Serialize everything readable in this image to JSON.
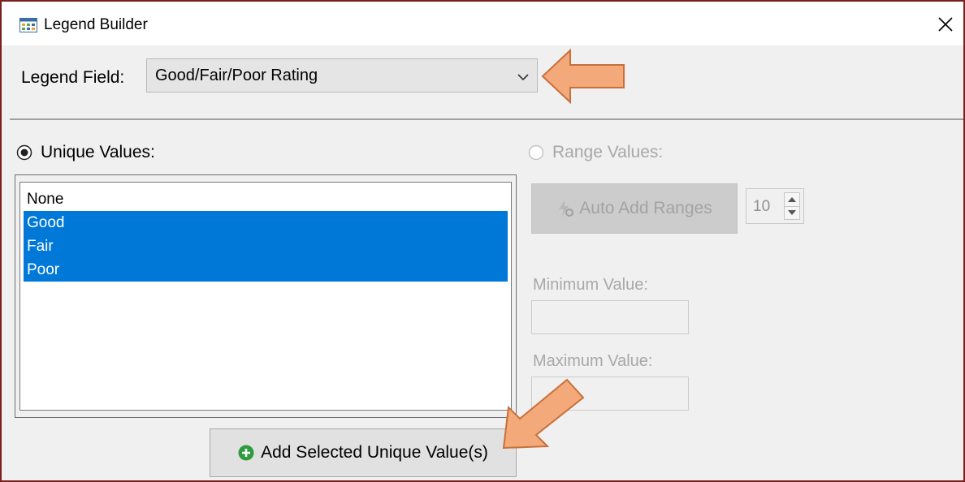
{
  "window": {
    "title": "Legend Builder",
    "icon": "legend-grid-icon"
  },
  "legend_field": {
    "label": "Legend Field:",
    "selected_value": "Good/Fair/Poor Rating"
  },
  "unique_values": {
    "label": "Unique Values:",
    "selected": true,
    "items": [
      {
        "label": "None",
        "selected": false
      },
      {
        "label": "Good",
        "selected": true
      },
      {
        "label": "Fair",
        "selected": true
      },
      {
        "label": "Poor",
        "selected": true
      }
    ]
  },
  "range_values": {
    "label": "Range Values:",
    "selected": false,
    "enabled": false,
    "auto_add_label": "Auto Add Ranges",
    "range_count": "10",
    "minimum_label": "Minimum Value:",
    "maximum_label": "Maximum Value:",
    "minimum_value": "",
    "maximum_value": ""
  },
  "buttons": {
    "add_selected_label": "Add Selected Unique Value(s)"
  },
  "colors": {
    "selection": "#0078d7",
    "window_border": "#7a1f1f",
    "annotation_arrow": "#f4a97a",
    "plus_icon": "#2e9b3e"
  }
}
